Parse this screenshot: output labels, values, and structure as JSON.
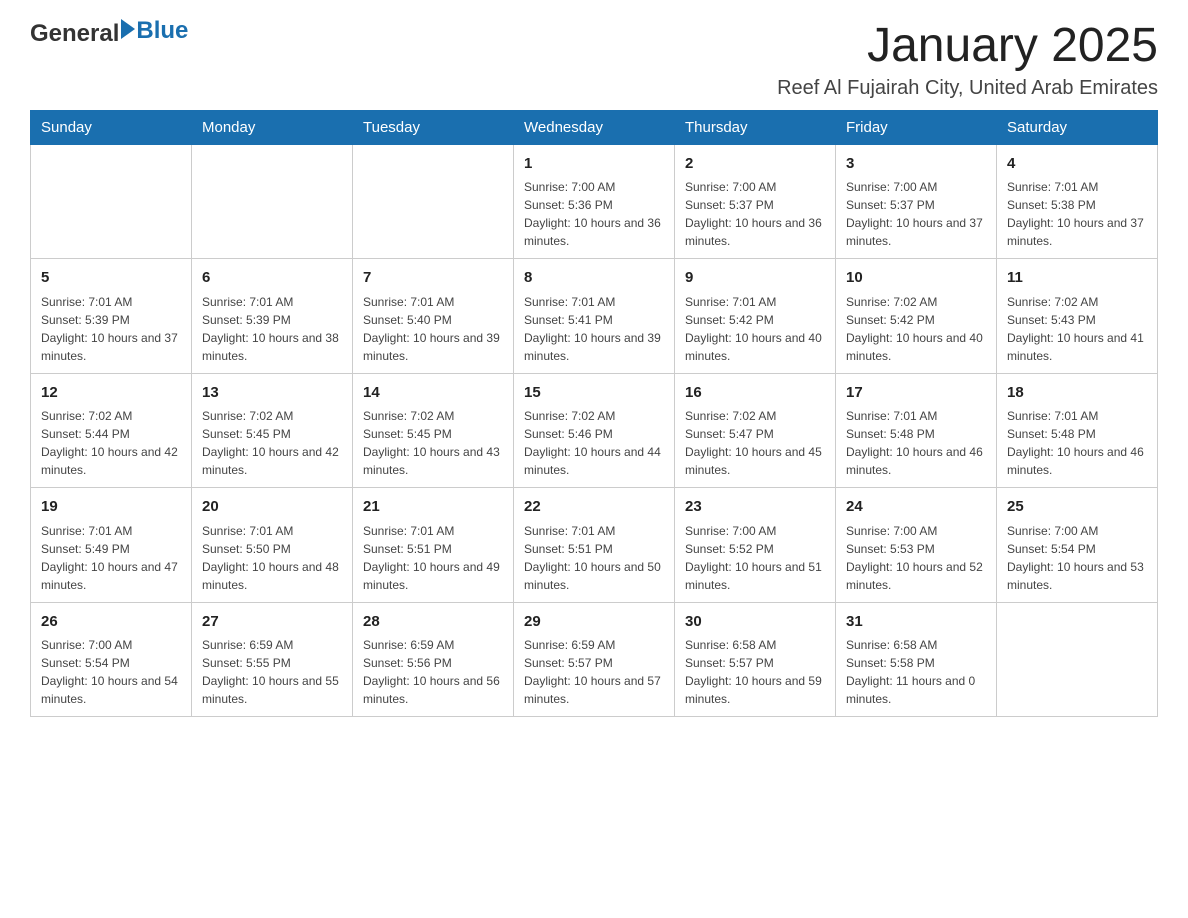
{
  "header": {
    "logo": {
      "general": "General",
      "arrow": "▶",
      "blue": "Blue"
    },
    "title": "January 2025",
    "location": "Reef Al Fujairah City, United Arab Emirates"
  },
  "days_header": [
    "Sunday",
    "Monday",
    "Tuesday",
    "Wednesday",
    "Thursday",
    "Friday",
    "Saturday"
  ],
  "weeks": [
    [
      {
        "day": "",
        "sunrise": "",
        "sunset": "",
        "daylight": ""
      },
      {
        "day": "",
        "sunrise": "",
        "sunset": "",
        "daylight": ""
      },
      {
        "day": "",
        "sunrise": "",
        "sunset": "",
        "daylight": ""
      },
      {
        "day": "1",
        "sunrise": "Sunrise: 7:00 AM",
        "sunset": "Sunset: 5:36 PM",
        "daylight": "Daylight: 10 hours and 36 minutes."
      },
      {
        "day": "2",
        "sunrise": "Sunrise: 7:00 AM",
        "sunset": "Sunset: 5:37 PM",
        "daylight": "Daylight: 10 hours and 36 minutes."
      },
      {
        "day": "3",
        "sunrise": "Sunrise: 7:00 AM",
        "sunset": "Sunset: 5:37 PM",
        "daylight": "Daylight: 10 hours and 37 minutes."
      },
      {
        "day": "4",
        "sunrise": "Sunrise: 7:01 AM",
        "sunset": "Sunset: 5:38 PM",
        "daylight": "Daylight: 10 hours and 37 minutes."
      }
    ],
    [
      {
        "day": "5",
        "sunrise": "Sunrise: 7:01 AM",
        "sunset": "Sunset: 5:39 PM",
        "daylight": "Daylight: 10 hours and 37 minutes."
      },
      {
        "day": "6",
        "sunrise": "Sunrise: 7:01 AM",
        "sunset": "Sunset: 5:39 PM",
        "daylight": "Daylight: 10 hours and 38 minutes."
      },
      {
        "day": "7",
        "sunrise": "Sunrise: 7:01 AM",
        "sunset": "Sunset: 5:40 PM",
        "daylight": "Daylight: 10 hours and 39 minutes."
      },
      {
        "day": "8",
        "sunrise": "Sunrise: 7:01 AM",
        "sunset": "Sunset: 5:41 PM",
        "daylight": "Daylight: 10 hours and 39 minutes."
      },
      {
        "day": "9",
        "sunrise": "Sunrise: 7:01 AM",
        "sunset": "Sunset: 5:42 PM",
        "daylight": "Daylight: 10 hours and 40 minutes."
      },
      {
        "day": "10",
        "sunrise": "Sunrise: 7:02 AM",
        "sunset": "Sunset: 5:42 PM",
        "daylight": "Daylight: 10 hours and 40 minutes."
      },
      {
        "day": "11",
        "sunrise": "Sunrise: 7:02 AM",
        "sunset": "Sunset: 5:43 PM",
        "daylight": "Daylight: 10 hours and 41 minutes."
      }
    ],
    [
      {
        "day": "12",
        "sunrise": "Sunrise: 7:02 AM",
        "sunset": "Sunset: 5:44 PM",
        "daylight": "Daylight: 10 hours and 42 minutes."
      },
      {
        "day": "13",
        "sunrise": "Sunrise: 7:02 AM",
        "sunset": "Sunset: 5:45 PM",
        "daylight": "Daylight: 10 hours and 42 minutes."
      },
      {
        "day": "14",
        "sunrise": "Sunrise: 7:02 AM",
        "sunset": "Sunset: 5:45 PM",
        "daylight": "Daylight: 10 hours and 43 minutes."
      },
      {
        "day": "15",
        "sunrise": "Sunrise: 7:02 AM",
        "sunset": "Sunset: 5:46 PM",
        "daylight": "Daylight: 10 hours and 44 minutes."
      },
      {
        "day": "16",
        "sunrise": "Sunrise: 7:02 AM",
        "sunset": "Sunset: 5:47 PM",
        "daylight": "Daylight: 10 hours and 45 minutes."
      },
      {
        "day": "17",
        "sunrise": "Sunrise: 7:01 AM",
        "sunset": "Sunset: 5:48 PM",
        "daylight": "Daylight: 10 hours and 46 minutes."
      },
      {
        "day": "18",
        "sunrise": "Sunrise: 7:01 AM",
        "sunset": "Sunset: 5:48 PM",
        "daylight": "Daylight: 10 hours and 46 minutes."
      }
    ],
    [
      {
        "day": "19",
        "sunrise": "Sunrise: 7:01 AM",
        "sunset": "Sunset: 5:49 PM",
        "daylight": "Daylight: 10 hours and 47 minutes."
      },
      {
        "day": "20",
        "sunrise": "Sunrise: 7:01 AM",
        "sunset": "Sunset: 5:50 PM",
        "daylight": "Daylight: 10 hours and 48 minutes."
      },
      {
        "day": "21",
        "sunrise": "Sunrise: 7:01 AM",
        "sunset": "Sunset: 5:51 PM",
        "daylight": "Daylight: 10 hours and 49 minutes."
      },
      {
        "day": "22",
        "sunrise": "Sunrise: 7:01 AM",
        "sunset": "Sunset: 5:51 PM",
        "daylight": "Daylight: 10 hours and 50 minutes."
      },
      {
        "day": "23",
        "sunrise": "Sunrise: 7:00 AM",
        "sunset": "Sunset: 5:52 PM",
        "daylight": "Daylight: 10 hours and 51 minutes."
      },
      {
        "day": "24",
        "sunrise": "Sunrise: 7:00 AM",
        "sunset": "Sunset: 5:53 PM",
        "daylight": "Daylight: 10 hours and 52 minutes."
      },
      {
        "day": "25",
        "sunrise": "Sunrise: 7:00 AM",
        "sunset": "Sunset: 5:54 PM",
        "daylight": "Daylight: 10 hours and 53 minutes."
      }
    ],
    [
      {
        "day": "26",
        "sunrise": "Sunrise: 7:00 AM",
        "sunset": "Sunset: 5:54 PM",
        "daylight": "Daylight: 10 hours and 54 minutes."
      },
      {
        "day": "27",
        "sunrise": "Sunrise: 6:59 AM",
        "sunset": "Sunset: 5:55 PM",
        "daylight": "Daylight: 10 hours and 55 minutes."
      },
      {
        "day": "28",
        "sunrise": "Sunrise: 6:59 AM",
        "sunset": "Sunset: 5:56 PM",
        "daylight": "Daylight: 10 hours and 56 minutes."
      },
      {
        "day": "29",
        "sunrise": "Sunrise: 6:59 AM",
        "sunset": "Sunset: 5:57 PM",
        "daylight": "Daylight: 10 hours and 57 minutes."
      },
      {
        "day": "30",
        "sunrise": "Sunrise: 6:58 AM",
        "sunset": "Sunset: 5:57 PM",
        "daylight": "Daylight: 10 hours and 59 minutes."
      },
      {
        "day": "31",
        "sunrise": "Sunrise: 6:58 AM",
        "sunset": "Sunset: 5:58 PM",
        "daylight": "Daylight: 11 hours and 0 minutes."
      },
      {
        "day": "",
        "sunrise": "",
        "sunset": "",
        "daylight": ""
      }
    ]
  ]
}
